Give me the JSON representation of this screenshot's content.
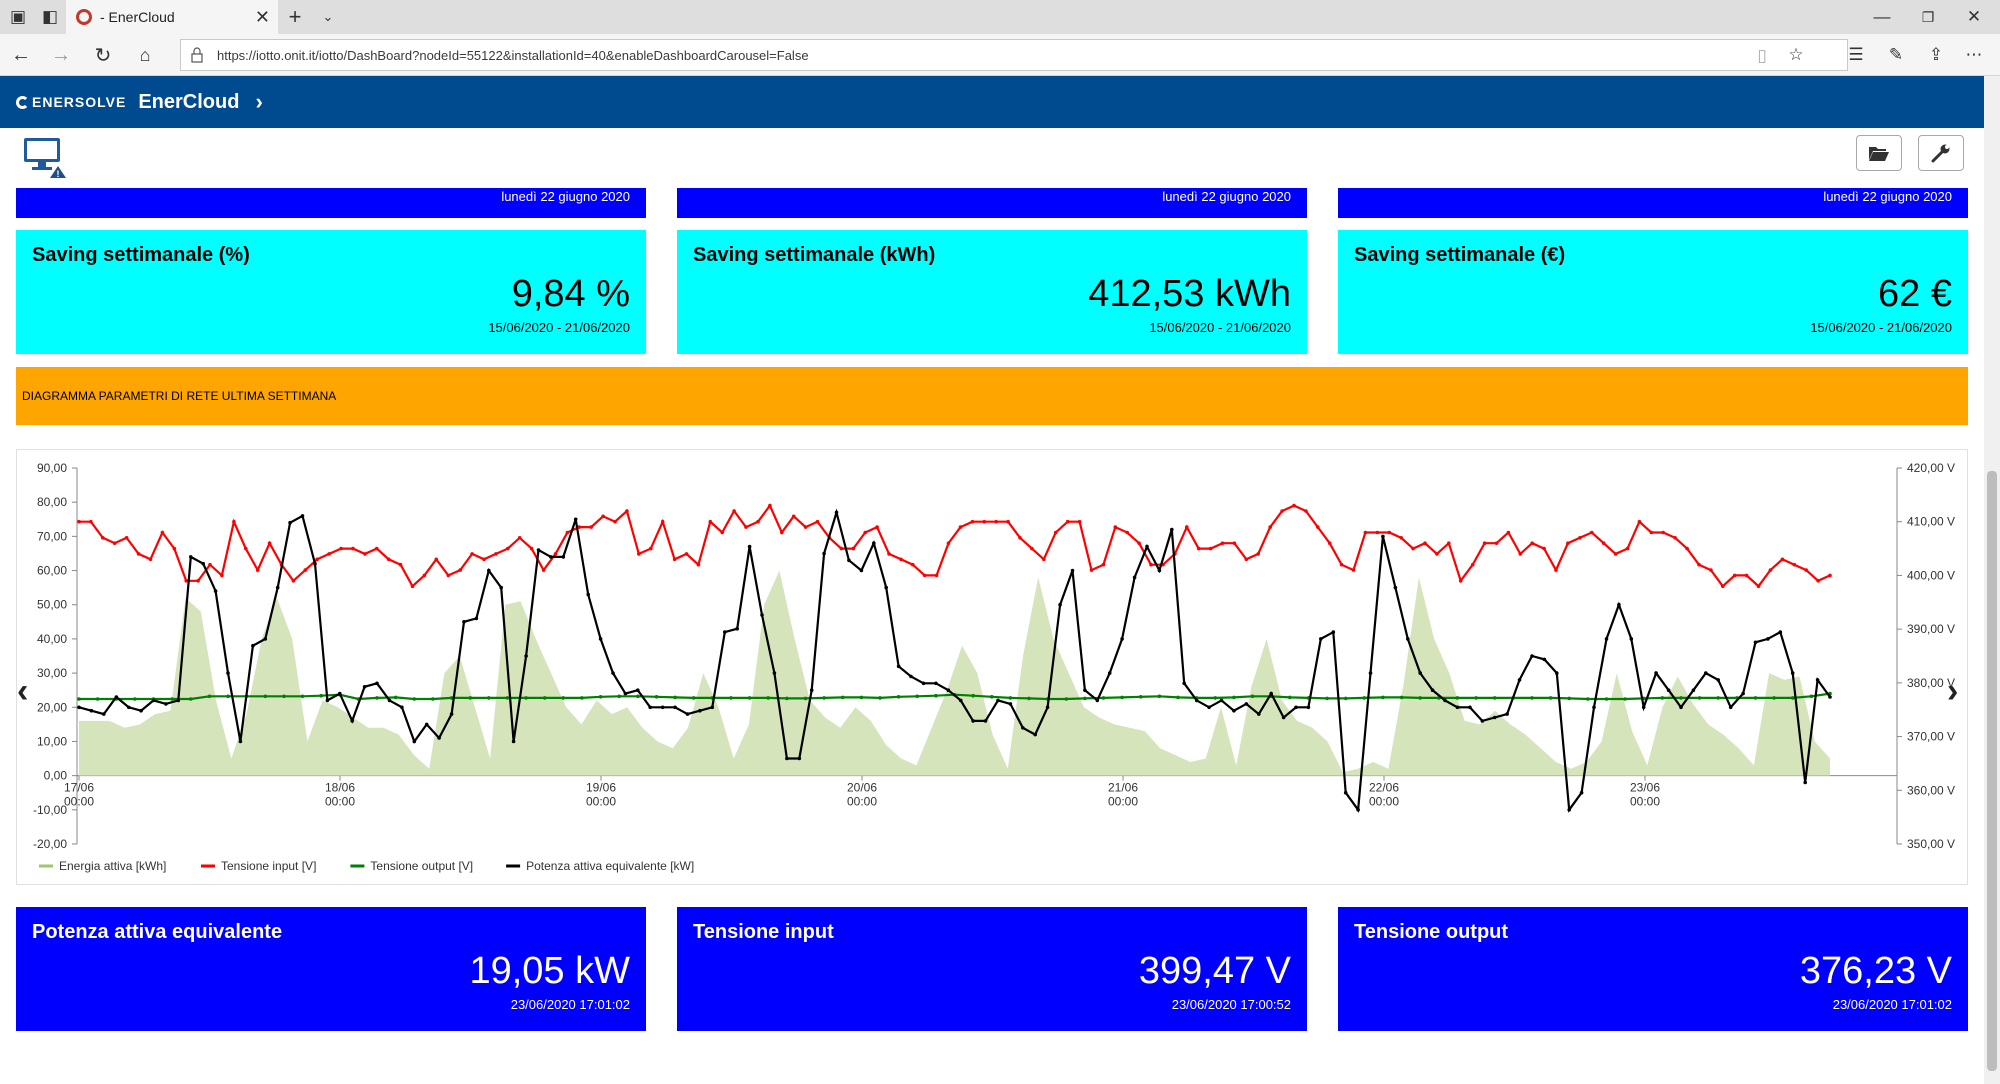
{
  "browser": {
    "tab_title": "- EnerCloud",
    "url": "https://iotto.onit.it/iotto/DashBoard?nodeId=55122&installationId=40&enableDashboardCarousel=False"
  },
  "header": {
    "logo_text": "ENERSOLVE",
    "app_title": "EnerCloud"
  },
  "top_strip_dates": [
    "lunedì 22 giugno 2020",
    "lunedì 22 giugno 2020",
    "lunedì 22 giugno 2020"
  ],
  "saving_cards": [
    {
      "title": "Saving settimanale (%)",
      "value": "9,84 %",
      "period": "15/06/2020 - 21/06/2020"
    },
    {
      "title": "Saving settimanale (kWh)",
      "value": "412,53 kWh",
      "period": "15/06/2020 - 21/06/2020"
    },
    {
      "title": "Saving settimanale (€)",
      "value": "62 €",
      "period": "15/06/2020 - 21/06/2020"
    }
  ],
  "banner": {
    "text": "DIAGRAMMA PARAMETRI DI RETE ULTIMA SETTIMANA"
  },
  "live_cards": [
    {
      "title": "Potenza attiva equivalente",
      "value": "19,05 kW",
      "timestamp": "23/06/2020 17:01:02"
    },
    {
      "title": "Tensione input",
      "value": "399,47 V",
      "timestamp": "23/06/2020 17:00:52"
    },
    {
      "title": "Tensione output",
      "value": "376,23 V",
      "timestamp": "23/06/2020 17:01:02"
    }
  ],
  "icons": {
    "monitor": "monitor-warning-icon",
    "folder": "folder-open-icon",
    "wrench": "wrench-icon"
  },
  "colors": {
    "header_blue": "#004a8f",
    "card_blue": "#0000ff",
    "card_cyan": "#00ffff",
    "banner_orange": "#ffa500",
    "energy_fill": "#d6e4bc",
    "tension_input": "#ff0000",
    "tension_output": "#008000",
    "power": "#000000"
  },
  "chart_data": {
    "type": "line",
    "x_labels": [
      "17/06 00:00",
      "18/06 00:00",
      "19/06 00:00",
      "20/06 00:00",
      "21/06 00:00",
      "22/06 00:00",
      "23/06 00:00"
    ],
    "y_left": {
      "min": -20,
      "max": 90,
      "step": 10,
      "ticks": [
        "90,00",
        "80,00",
        "70,00",
        "60,00",
        "50,00",
        "40,00",
        "30,00",
        "20,00",
        "10,00",
        "0,00",
        "-10,00",
        "-20,00"
      ]
    },
    "y_right": {
      "min": 350,
      "max": 420,
      "ticks": [
        "420,00 V",
        "410,00 V",
        "400,00 V",
        "390,00 V",
        "380,00 V",
        "370,00 V",
        "360,00 V",
        "350,00 V"
      ]
    },
    "legend": [
      "Energia attiva [kWh]",
      "Tensione input [V]",
      "Tensione output [V]",
      "Potenza attiva equivalente [kW]"
    ],
    "grid": false,
    "legend_position": "bottom-left",
    "series": [
      {
        "name": "Energia attiva [kWh]",
        "axis": "left",
        "style": "area",
        "values": [
          16,
          16,
          16,
          14,
          15,
          18,
          19,
          52,
          48,
          22,
          5,
          18,
          40,
          52,
          40,
          10,
          22,
          20,
          17,
          14,
          14,
          12,
          6,
          2,
          30,
          35,
          20,
          5,
          50,
          51,
          40,
          30,
          20,
          15,
          22,
          18,
          20,
          14,
          10,
          8,
          14,
          30,
          20,
          5,
          15,
          50,
          60,
          40,
          22,
          17,
          14,
          20,
          16,
          9,
          5,
          3,
          14,
          25,
          38,
          30,
          12,
          2,
          35,
          58,
          40,
          30,
          20,
          17,
          15,
          14,
          13,
          8,
          6,
          4,
          5,
          20,
          3,
          26,
          40,
          22,
          16,
          14,
          10,
          1,
          2,
          4,
          2,
          27,
          58,
          40,
          30,
          16,
          15,
          19,
          15,
          12,
          8,
          4,
          2,
          4,
          10,
          30,
          13,
          3,
          20,
          29,
          21,
          15,
          12,
          8,
          3,
          30,
          28,
          29,
          10,
          5
        ]
      },
      {
        "name": "Tensione input [V]",
        "axis": "right",
        "style": "line",
        "values": [
          410,
          410,
          407,
          406,
          407,
          404,
          403,
          408,
          405,
          399,
          399,
          402,
          400,
          410,
          405,
          401,
          406,
          402,
          399,
          401,
          403,
          404,
          405,
          405,
          404,
          405,
          403,
          402,
          398,
          400,
          403,
          400,
          401,
          404,
          403,
          404,
          405,
          407,
          405,
          401,
          404,
          408,
          409,
          409,
          411,
          410,
          412,
          404,
          405,
          410,
          403,
          404,
          402,
          410,
          408,
          412,
          409,
          410,
          413,
          408,
          411,
          409,
          410,
          407,
          405,
          405,
          408,
          409,
          404,
          403,
          402,
          400,
          400,
          406,
          409,
          410,
          410,
          410,
          410,
          407,
          405,
          403,
          408,
          410,
          410,
          401,
          402,
          409,
          408,
          406,
          402,
          402,
          404,
          409,
          405,
          405,
          406,
          406,
          403,
          404,
          409,
          412,
          413,
          412,
          409,
          406,
          402,
          401,
          408,
          408,
          408,
          407,
          405,
          406,
          404,
          406,
          399,
          402,
          406,
          406,
          408,
          404,
          406,
          405,
          401,
          406,
          407,
          408,
          406,
          404,
          405,
          410,
          408,
          408,
          407,
          405,
          402,
          401,
          398,
          400,
          400,
          398,
          401,
          403,
          402,
          401,
          399,
          400
        ]
      },
      {
        "name": "Tensione output [V]",
        "axis": "right",
        "style": "line",
        "values": [
          377,
          377,
          377,
          377,
          377,
          377,
          377,
          377.5,
          377.5,
          377.5,
          377.5,
          377.5,
          377.5,
          377.6,
          377.8,
          377,
          377.2,
          377.3,
          377,
          377,
          377.2,
          377.2,
          377.2,
          377.2,
          377.2,
          377.2,
          377.2,
          377.2,
          377.4,
          377.5,
          377.5,
          377.4,
          377.3,
          377.2,
          377.2,
          377.2,
          377.2,
          377.2,
          377.1,
          377.1,
          377.2,
          377.3,
          377.3,
          377.2,
          377.4,
          377.5,
          377.6,
          377.8,
          377.6,
          377.4,
          377.2,
          377.1,
          377,
          377,
          377.1,
          377.2,
          377.3,
          377.4,
          377.5,
          377.3,
          377.2,
          377.2,
          377.3,
          377.5,
          377.5,
          377.3,
          377.2,
          377.1,
          377.1,
          377.2,
          377.3,
          377.3,
          377.2,
          377.2,
          377.2,
          377.2,
          377.2,
          377.2,
          377.2,
          377.2,
          377.1,
          377,
          377,
          377,
          377.1,
          377.2,
          377.2,
          377.2,
          377.2,
          377.2,
          377.2,
          377.2,
          377.2,
          377.5,
          378
        ]
      },
      {
        "name": "Potenza attiva equivalente [kW]",
        "axis": "left",
        "style": "line",
        "values": [
          20,
          19,
          18,
          23,
          20,
          19,
          22,
          21,
          22,
          64,
          62,
          54,
          30,
          10,
          38,
          40,
          55,
          74,
          76,
          62,
          22,
          24,
          16,
          26,
          27,
          22,
          20,
          10,
          15,
          11,
          18,
          45,
          46,
          60,
          55,
          10,
          35,
          66,
          64,
          64,
          75,
          53,
          40,
          30,
          24,
          25,
          20,
          20,
          20,
          18,
          19,
          20,
          42,
          43,
          67,
          47,
          30,
          5,
          5,
          25,
          65,
          77,
          63,
          60,
          68,
          55,
          32,
          29,
          27,
          27,
          25,
          22,
          16,
          16,
          22,
          21,
          14,
          12,
          20,
          50,
          60,
          25,
          22,
          30,
          40,
          58,
          67,
          60,
          72,
          27,
          22,
          20,
          22,
          19,
          21,
          18,
          24,
          17,
          20,
          20,
          40,
          42,
          -5,
          -10,
          30,
          70,
          55,
          40,
          30,
          25,
          22,
          20,
          20,
          16,
          17,
          18,
          28,
          35,
          34,
          30,
          -10,
          -5,
          20,
          40,
          50,
          40,
          20,
          30,
          25,
          20,
          25,
          30,
          28,
          20,
          24,
          39,
          40,
          42,
          30,
          -2,
          28,
          23
        ]
      }
    ]
  }
}
